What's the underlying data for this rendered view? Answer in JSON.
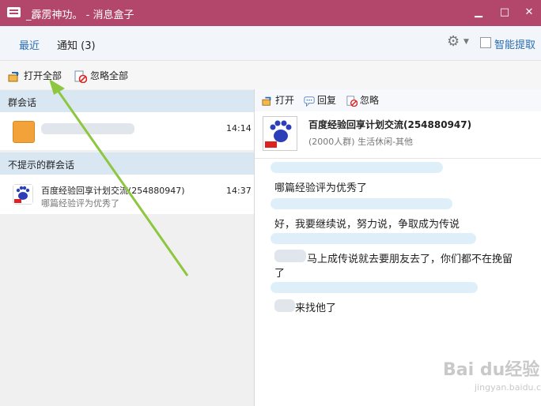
{
  "window": {
    "title": "_霹雳神功。 - 消息盒子",
    "minimize": "▁",
    "maximize": "□",
    "close": "✕"
  },
  "topnav": {
    "recent": "最近",
    "notify": "通知 (3)",
    "smart_pick": "智能提取"
  },
  "toolbar": {
    "open_all": "打开全部",
    "ignore_all": "忽略全部"
  },
  "left": {
    "section_group": "群会话",
    "item1": {
      "time": "14:14"
    },
    "section_silent": "不提示的群会话",
    "item2": {
      "name": "百度经验回享计划交流(254880947)",
      "sub": "哪篇经验评为优秀了",
      "time": "14:37"
    }
  },
  "right": {
    "open": "打开",
    "reply": "回复",
    "ignore": "忽略",
    "group_name": "百度经验回享计划交流(254880947)",
    "group_meta": "(2000人群) 生活休闲-其他",
    "messages": [
      {
        "text": "哪篇经验评为优秀了"
      },
      {
        "text": "好，我要继续说，努力说，争取成为传说"
      },
      {
        "text": "马上成传说就去要朋友去了，你们都不在挽留"
      },
      {
        "text": "了"
      },
      {
        "text": "来找他了"
      }
    ]
  },
  "watermark": {
    "brand": "Bai du经验",
    "url": "jingyan.baidu.com"
  }
}
